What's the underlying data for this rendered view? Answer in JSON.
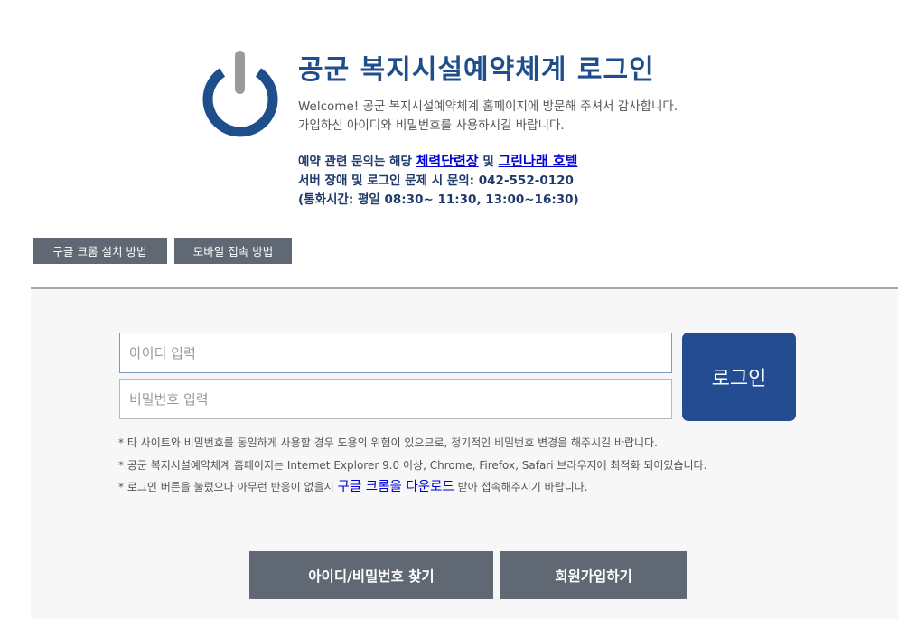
{
  "header": {
    "title": "공군 복지시설예약체계 로그인",
    "welcome_line1": "Welcome! 공군 복지시설예약체계 홈페이지에 방문해 주셔서 감사합니다.",
    "welcome_line2": "가입하신 아이디와 비밀번호를 사용하시길 바랍니다.",
    "contact_prefix": "예약 관련 문의는 해당",
    "contact_link1": "체력단련장",
    "contact_mid": "및",
    "contact_link2": "그린나래 호텔",
    "contact_line2": "서버 장애 및 로그인 문제 시 문의: 042-552-0120",
    "contact_line3": "(통화시간: 평일 08:30~ 11:30, 13:00~16:30)",
    "icon": "power-icon",
    "accent_color": "#1f4e8c"
  },
  "guide_buttons": {
    "chrome_install": "구글 크롬 설치 방법",
    "mobile_access": "모바일 접속 방법"
  },
  "login_form": {
    "id_placeholder": "아이디 입력",
    "id_value": "",
    "pw_placeholder": "비밀번호 입력",
    "pw_value": "",
    "login_label": "로그인",
    "login_color": "#244c90"
  },
  "notes": {
    "note1": "* 타 사이트와 비밀번호를 동일하게 사용할 경우 도용의 위험이 있으므로, 정기적인 비밀번호 변경을 해주시길 바랍니다.",
    "note2": "* 공군 복지시설예약체계 홈페이지는 Internet Explorer 9.0 이상, Chrome, Firefox, Safari 브라우저에 최적화 되어있습니다.",
    "note3_prefix": "* 로그인 버튼을 눌렀으나 아무런 반응이 없을시",
    "note3_link": "구글 크롬을 다운로드",
    "note3_suffix": "받아 접속해주시기 바랍니다."
  },
  "bottom_buttons": {
    "find_account": "아이디/비밀번호 찾기",
    "register": "회원가입하기"
  }
}
